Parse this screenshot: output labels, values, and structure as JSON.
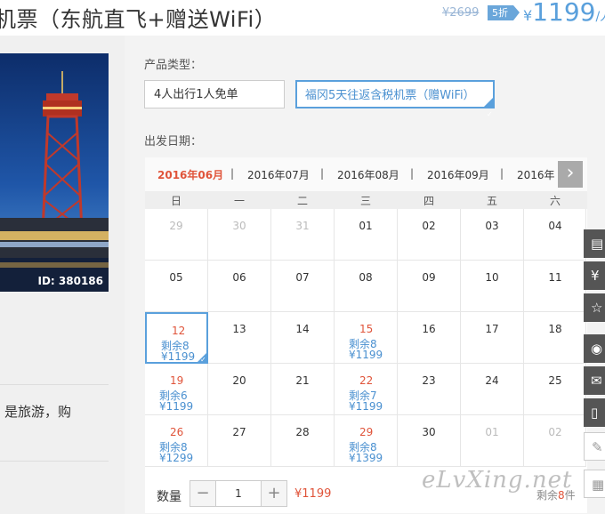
{
  "header": {
    "title": "机票（东航直飞+赠送WiFi）",
    "original_price": "¥2699",
    "discount": "5折",
    "price_currency": "¥",
    "price": "1199",
    "price_unit": "/人"
  },
  "photo": {
    "id_label": "ID: 380186"
  },
  "description": {
    "text": "是旅游，购"
  },
  "product_type": {
    "label": "产品类型：",
    "options": [
      {
        "label": "4人出行1人免单",
        "selected": false
      },
      {
        "label": "福冈5天往返含税机票（赠WiFi）",
        "selected": true
      }
    ]
  },
  "departure": {
    "label": "出发日期：",
    "months": [
      "2016年06月",
      "2016年07月",
      "2016年08月",
      "2016年09月",
      "2016年"
    ],
    "current_month_index": 0,
    "separator": "|",
    "next_icon": "chevron-right-icon",
    "weekdays": [
      "日",
      "一",
      "二",
      "三",
      "四",
      "五",
      "六"
    ],
    "weeks": [
      [
        {
          "d": "29",
          "dim": true
        },
        {
          "d": "30",
          "dim": true
        },
        {
          "d": "31",
          "dim": true
        },
        {
          "d": "01"
        },
        {
          "d": "02"
        },
        {
          "d": "03"
        },
        {
          "d": "04"
        }
      ],
      [
        {
          "d": "05"
        },
        {
          "d": "06"
        },
        {
          "d": "07"
        },
        {
          "d": "08"
        },
        {
          "d": "09"
        },
        {
          "d": "10"
        },
        {
          "d": "11"
        }
      ],
      [
        {
          "d": "12",
          "rem": "剩余8",
          "price": "¥1199",
          "selected": true
        },
        {
          "d": "13"
        },
        {
          "d": "14"
        },
        {
          "d": "15",
          "rem": "剩余8",
          "price": "¥1199"
        },
        {
          "d": "16"
        },
        {
          "d": "17"
        },
        {
          "d": "18"
        }
      ],
      [
        {
          "d": "19",
          "rem": "剩余6",
          "price": "¥1199"
        },
        {
          "d": "20"
        },
        {
          "d": "21"
        },
        {
          "d": "22",
          "rem": "剩余7",
          "price": "¥1199"
        },
        {
          "d": "23"
        },
        {
          "d": "24"
        },
        {
          "d": "25"
        }
      ],
      [
        {
          "d": "26",
          "rem": "剩余8",
          "price": "¥1299"
        },
        {
          "d": "27"
        },
        {
          "d": "28"
        },
        {
          "d": "29",
          "rem": "剩余8",
          "price": "¥1399"
        },
        {
          "d": "30"
        },
        {
          "d": "01",
          "dim": true
        },
        {
          "d": "02",
          "dim": true
        }
      ]
    ]
  },
  "quantity": {
    "label": "数量",
    "minus": "−",
    "value": "1",
    "plus": "+",
    "total": "¥1199",
    "stock_prefix": "剩余",
    "stock_count": "8",
    "stock_suffix": "件"
  },
  "watermark": "eLvXing.net",
  "side_toolbar": [
    {
      "icon": "notepad-icon",
      "glyph": "▤"
    },
    {
      "icon": "yen-icon",
      "glyph": "¥"
    },
    {
      "icon": "star-icon",
      "glyph": "☆"
    },
    {
      "icon": "weibo-icon",
      "glyph": "◉"
    },
    {
      "icon": "wechat-icon",
      "glyph": "✉"
    },
    {
      "icon": "phone-icon",
      "glyph": "▯"
    },
    {
      "icon": "pencil-icon",
      "glyph": "✎"
    },
    {
      "icon": "qrcode-icon",
      "glyph": "▦"
    }
  ],
  "colors": {
    "accent": "#5aa0dc",
    "highlight": "#e0543a"
  }
}
